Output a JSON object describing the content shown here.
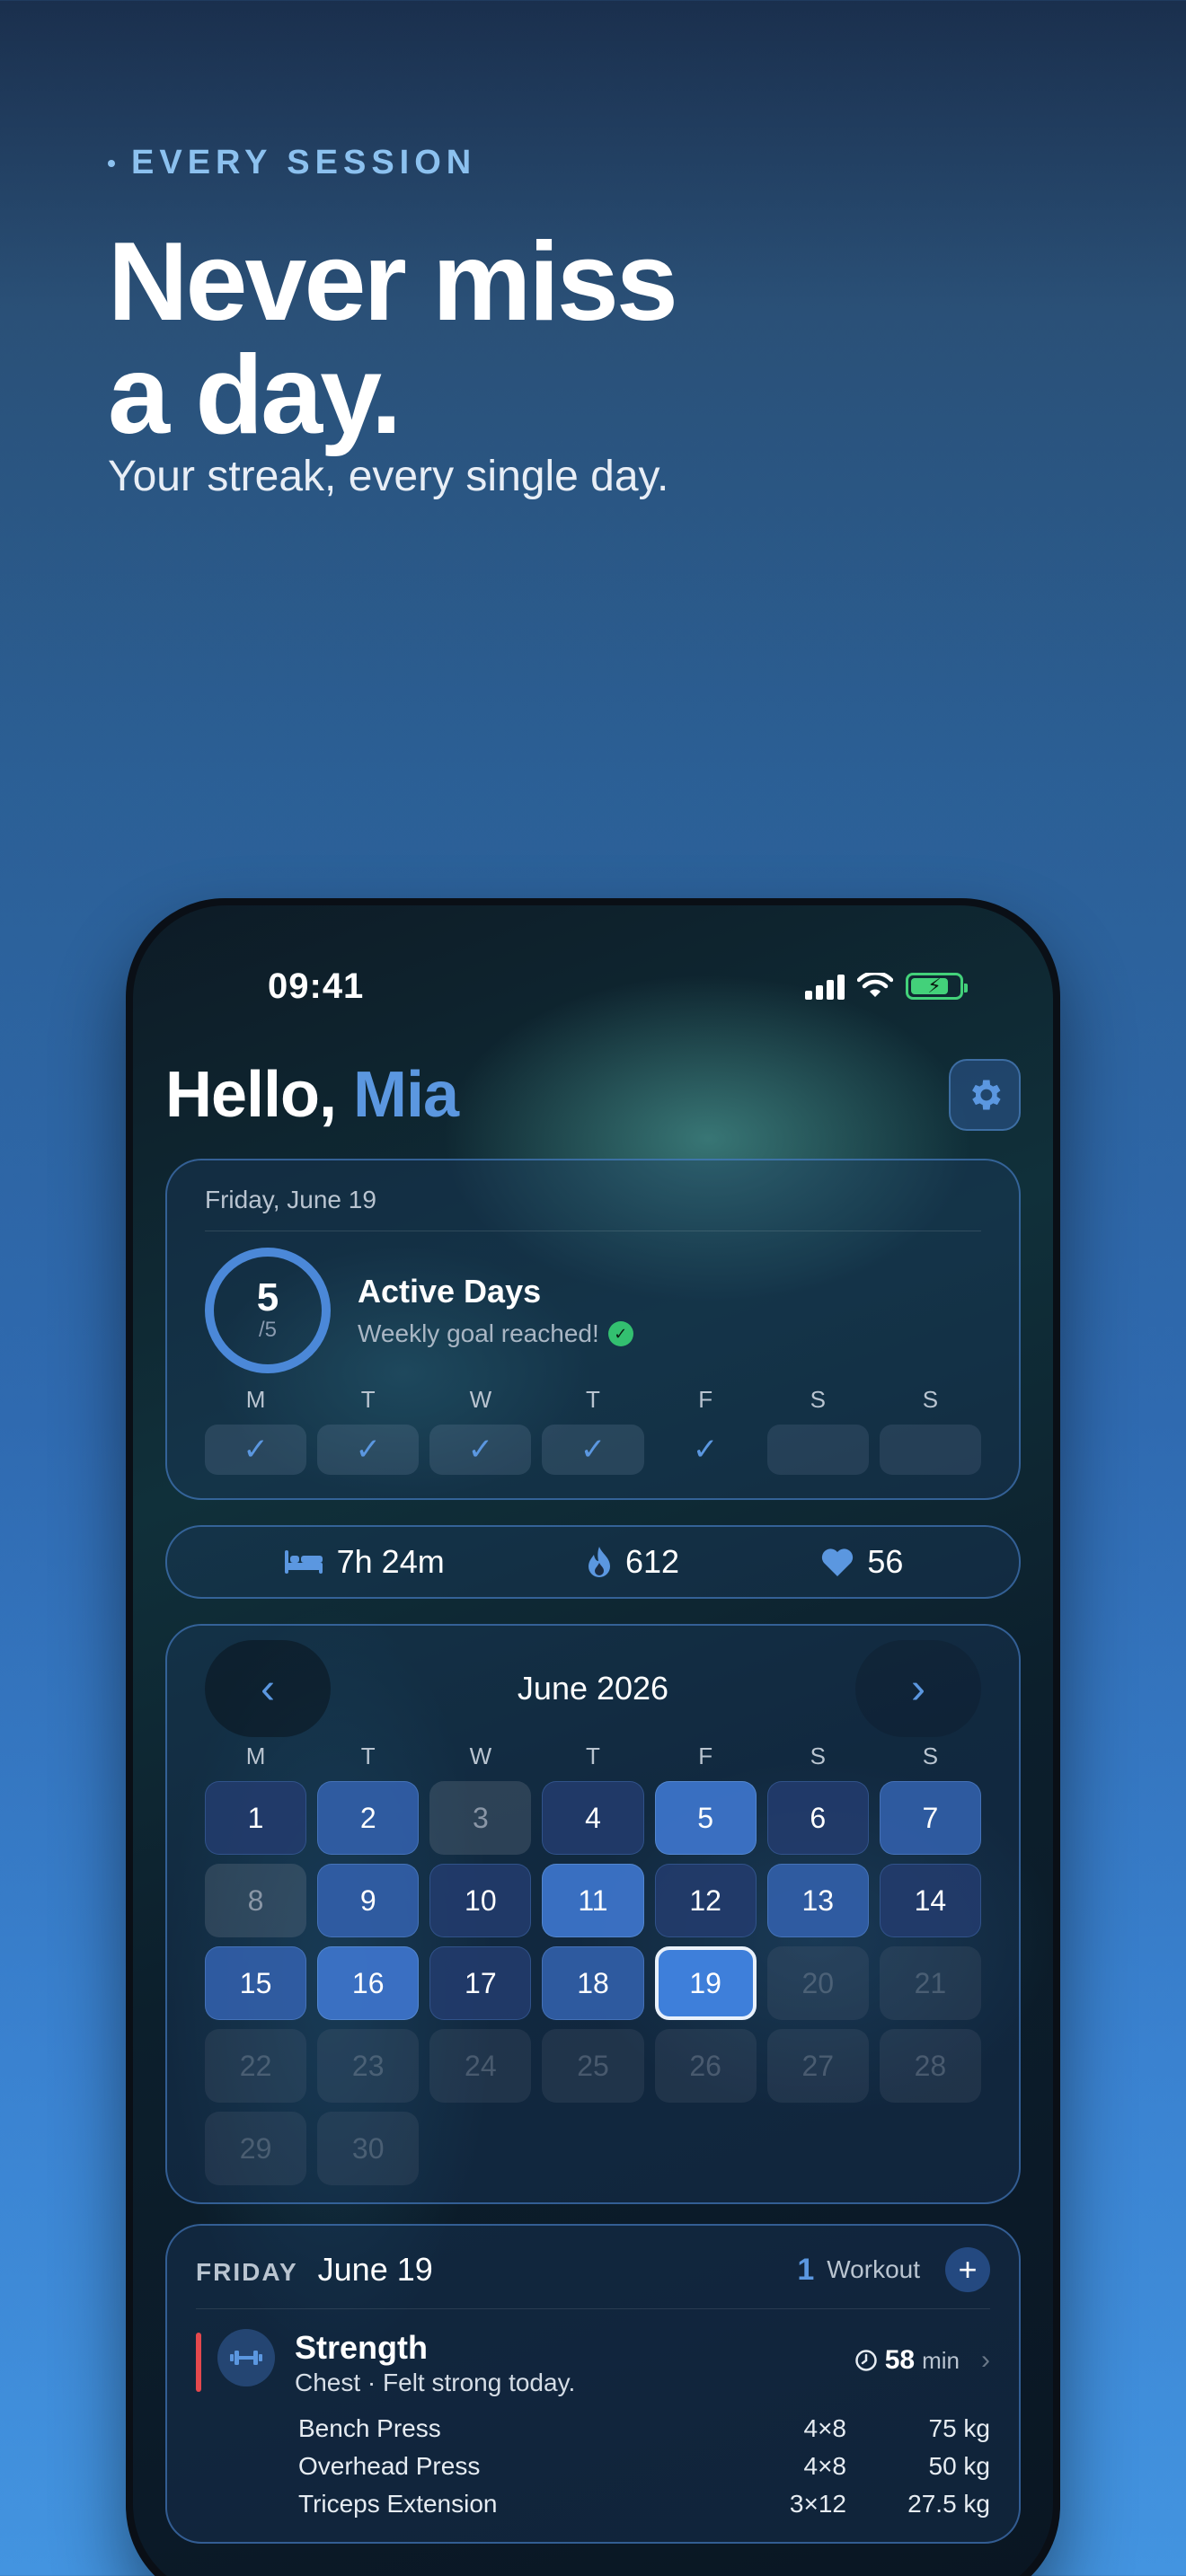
{
  "marketing": {
    "eyebrow": "EVERY SESSION",
    "headline_line1": "Never miss",
    "headline_line2": "a day.",
    "tagline": "Your streak, every single day."
  },
  "status_bar": {
    "time": "09:41",
    "icons": [
      "cellular-signal-icon",
      "wifi-icon",
      "battery-charging-icon"
    ]
  },
  "header": {
    "greeting": "Hello,",
    "name": "Mia",
    "settings_icon": "gear-icon"
  },
  "summary": {
    "date": "Friday, June 19",
    "ring_value": "5",
    "ring_total": "/5",
    "title": "Active Days",
    "subtitle": "Weekly goal reached!",
    "week_labels": [
      "M",
      "T",
      "W",
      "T",
      "F",
      "S",
      "S"
    ],
    "week_done": [
      true,
      true,
      true,
      true,
      true,
      false,
      false
    ]
  },
  "stats": {
    "sleep": "7h 24m",
    "calories": "612",
    "heart_rate": "56"
  },
  "calendar": {
    "title": "June 2026",
    "weekday_labels": [
      "M",
      "T",
      "W",
      "T",
      "F",
      "S",
      "S"
    ],
    "days": [
      {
        "d": "1",
        "level": 1
      },
      {
        "d": "2",
        "level": 2
      },
      {
        "d": "3",
        "level": 0
      },
      {
        "d": "4",
        "level": 1
      },
      {
        "d": "5",
        "level": 3
      },
      {
        "d": "6",
        "level": 1
      },
      {
        "d": "7",
        "level": 2
      },
      {
        "d": "8",
        "level": 0
      },
      {
        "d": "9",
        "level": 2
      },
      {
        "d": "10",
        "level": 1
      },
      {
        "d": "11",
        "level": 3
      },
      {
        "d": "12",
        "level": 1
      },
      {
        "d": "13",
        "level": 2
      },
      {
        "d": "14",
        "level": 1
      },
      {
        "d": "15",
        "level": 2
      },
      {
        "d": "16",
        "level": 3
      },
      {
        "d": "17",
        "level": 1
      },
      {
        "d": "18",
        "level": 2
      },
      {
        "d": "19",
        "level": "today"
      },
      {
        "d": "20",
        "level": "future"
      },
      {
        "d": "21",
        "level": "future"
      },
      {
        "d": "22",
        "level": "future"
      },
      {
        "d": "23",
        "level": "future"
      },
      {
        "d": "24",
        "level": "future"
      },
      {
        "d": "25",
        "level": "future"
      },
      {
        "d": "26",
        "level": "future"
      },
      {
        "d": "27",
        "level": "future"
      },
      {
        "d": "28",
        "level": "future"
      },
      {
        "d": "29",
        "level": "future"
      },
      {
        "d": "30",
        "level": "future"
      }
    ]
  },
  "workout": {
    "day_of_week": "FRIDAY",
    "date": "June 19",
    "count": "1",
    "count_unit": "Workout",
    "session": {
      "title": "Strength",
      "subtitle": "Chest · Felt strong today.",
      "duration": "58",
      "duration_unit": "min",
      "exercises": [
        {
          "name": "Bench Press",
          "sets": "4×8",
          "weight": "75 kg"
        },
        {
          "name": "Overhead Press",
          "sets": "4×8",
          "weight": "50 kg"
        },
        {
          "name": "Triceps Extension",
          "sets": "3×12",
          "weight": "27.5 kg"
        }
      ]
    }
  },
  "colors": {
    "accent": "#5b97e0",
    "today": "#3e7fda",
    "workout_strength": "#e5484d",
    "goal_check": "#33c070"
  }
}
